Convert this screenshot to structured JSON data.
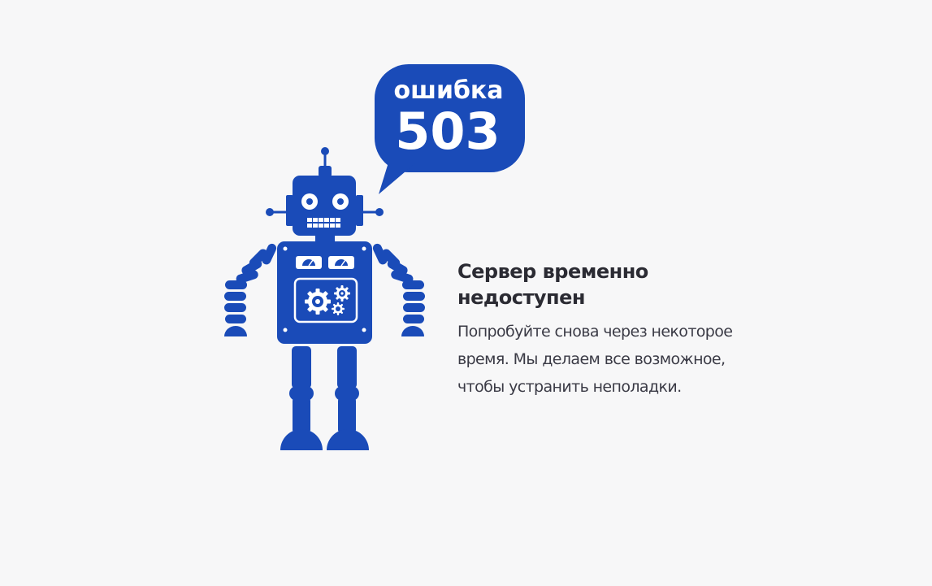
{
  "error": {
    "word": "ошибка",
    "code": "503"
  },
  "message": {
    "title_line1": "Сервер временно",
    "title_line2": "недоступен",
    "desc_line1": "Попробуйте снова через некоторое",
    "desc_line2": "время. Мы делаем все возможное,",
    "desc_line3": "чтобы устранить неполадки."
  },
  "colors": {
    "brand_blue": "#1a4bb8",
    "background": "#f7f7f8",
    "text_dark": "#2b2b33"
  },
  "icons": [
    "robot-illustration",
    "speech-bubble",
    "gear-icon",
    "gauge-icon"
  ]
}
